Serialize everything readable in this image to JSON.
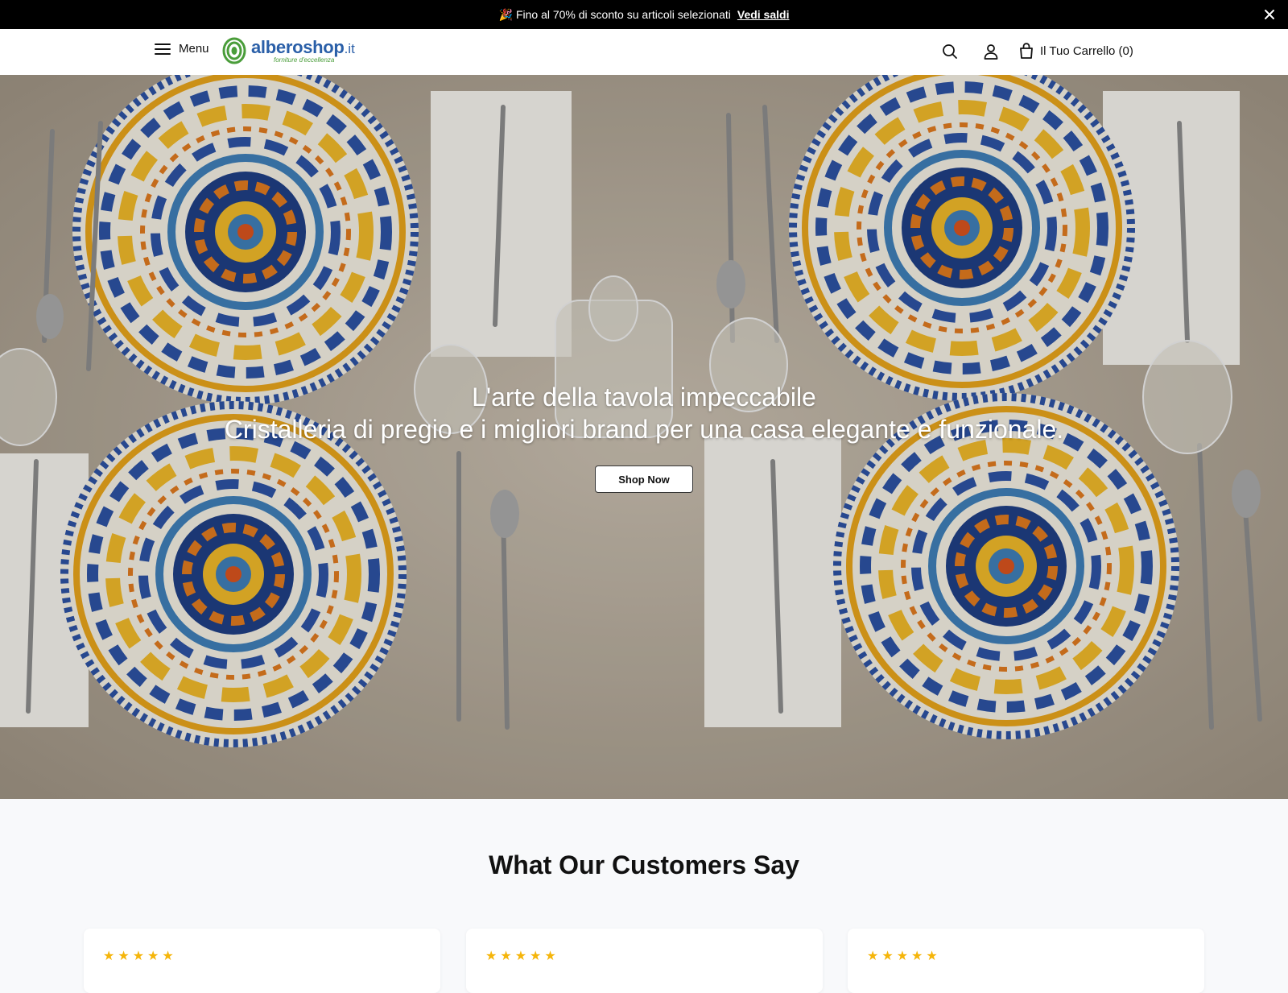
{
  "announcement": {
    "text": "Fino al 70% di sconto su articoli selezionati",
    "link": "Vedi saldi",
    "emoji_icon": "party-popper-icon"
  },
  "header": {
    "menu_label": "Menu",
    "logo": {
      "brand": "alberoshop",
      "tld": ".it",
      "tagline": "forniture d'eccellenza"
    },
    "cart_label": "Il Tuo Carrello (0)",
    "icons": [
      "hamburger-icon",
      "search-icon",
      "user-icon",
      "bag-icon"
    ]
  },
  "hero": {
    "title": "L'arte della tavola impeccabile",
    "subtitle": "Cristalleria di pregio e i migliori brand per una casa elegante e funzionale.",
    "button": "Shop Now"
  },
  "reviews": {
    "title": "What Our Customers Say",
    "cards": [
      {
        "stars": "★★★★★",
        "rating": 5
      },
      {
        "stars": "★★★★★",
        "rating": 5
      },
      {
        "stars": "★★★★★",
        "rating": 5
      }
    ]
  },
  "colors": {
    "announcement_bg": "#000000",
    "brand_blue": "#2a5fa8",
    "brand_green": "#4a9d3a",
    "star": "#f5b50a",
    "page_bg": "#f8f9fb"
  }
}
